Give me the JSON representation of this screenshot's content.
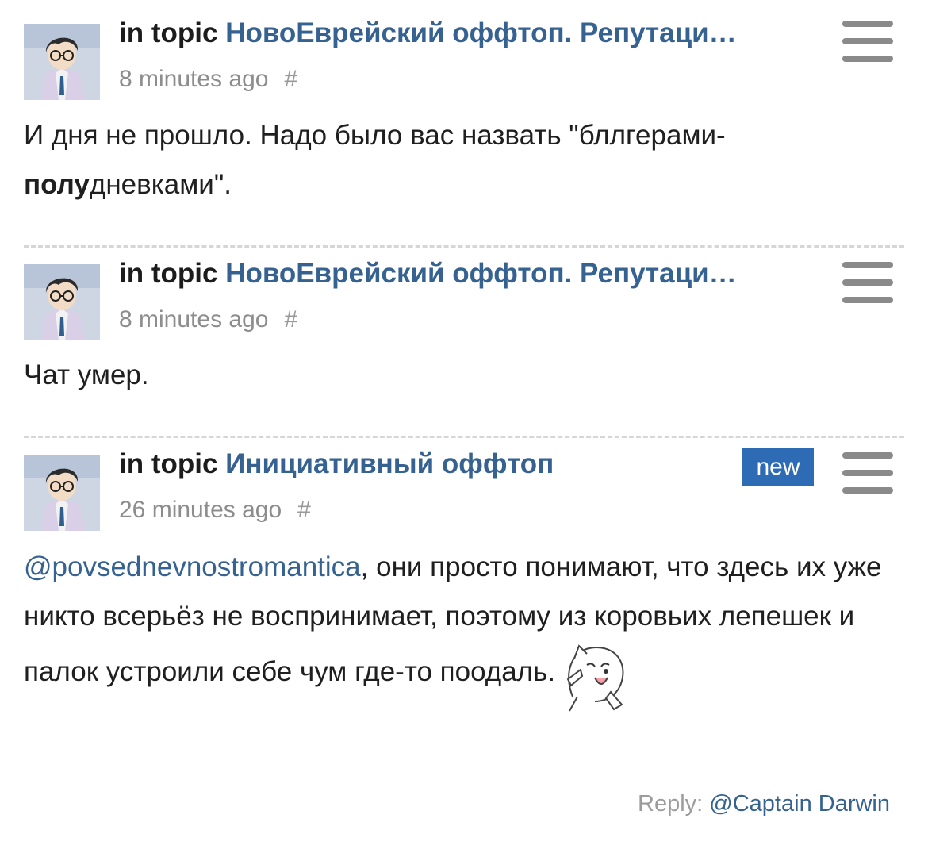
{
  "posts": [
    {
      "topic_prefix": "in topic",
      "topic_title": "НовоЕврейский оффтоп. Репутаци…",
      "time": "8 minutes ago",
      "hash": "#",
      "body_part1": "И дня не прошло. Надо было вас назвать \"бллгерами-",
      "body_bold": "полу",
      "body_part2": "дневками\"."
    },
    {
      "topic_prefix": "in topic",
      "topic_title": "НовоЕврейский оффтоп. Репутаци…",
      "time": "8 minutes ago",
      "hash": "#",
      "body": "Чат умер."
    },
    {
      "topic_prefix": "in topic",
      "topic_title": "Инициативный оффтоп",
      "badge": "new",
      "time": "26 minutes ago",
      "hash": "#",
      "mention": "@povsednevnostromantica",
      "body": ", они просто понимают, что здесь их уже никто всерьёз не воспринимает, поэтому из коровьих лепешек и палок устроили себе чум где-то поодаль.",
      "reply_label": "Reply:",
      "reply_user": "@Captain Darwin"
    }
  ],
  "colors": {
    "link": "#356290",
    "badge_bg": "#2e6bb5",
    "meta": "#8d8d8d",
    "menu_icon": "#8a8a8a"
  },
  "icons": {
    "menu": "hamburger-menu-icon",
    "sticker": "smiling-cat-sticker"
  }
}
